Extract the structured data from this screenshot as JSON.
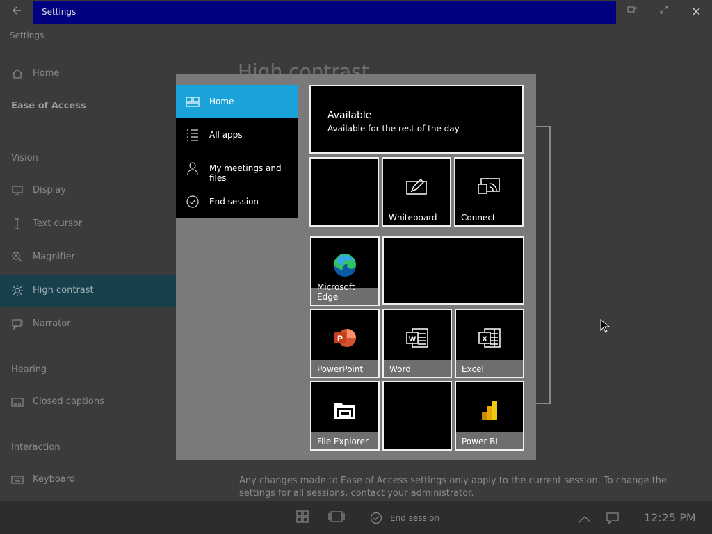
{
  "window": {
    "title": "Settings",
    "back_icon": "back-arrow-icon",
    "controls": [
      "pin-icon",
      "expand-icon",
      "close-icon"
    ]
  },
  "sidebar": {
    "app_caption": "Settings",
    "home": {
      "label": "Home",
      "icon": "home-icon"
    },
    "section": "Ease of Access",
    "groups": [
      {
        "heading": "Vision",
        "items": [
          {
            "label": "Display",
            "icon": "monitor-icon"
          },
          {
            "label": "Text cursor",
            "icon": "text-cursor-icon"
          },
          {
            "label": "Magnifier",
            "icon": "magnifier-icon"
          },
          {
            "label": "High contrast",
            "icon": "contrast-sun-icon",
            "active": true
          },
          {
            "label": "Narrator",
            "icon": "narrator-icon"
          }
        ]
      },
      {
        "heading": "Hearing",
        "items": [
          {
            "label": "Closed captions",
            "icon": "captions-icon"
          }
        ]
      },
      {
        "heading": "Interaction",
        "items": [
          {
            "label": "Keyboard",
            "icon": "keyboard-icon"
          }
        ]
      }
    ]
  },
  "main": {
    "title": "High contrast",
    "footnote": "Any changes made to Ease of Access settings only apply to the current session. To change the settings for all sessions, contact your administrator."
  },
  "start_menu": {
    "nav": [
      {
        "label": "Home",
        "icon": "home-tiles-icon",
        "active": true
      },
      {
        "label": "All apps",
        "icon": "list-icon"
      },
      {
        "label": "My meetings and files",
        "icon": "person-icon"
      },
      {
        "label": "End session",
        "icon": "check-circle-icon"
      }
    ],
    "status": {
      "title": "Available",
      "subtitle": "Available for the rest of the day"
    },
    "tiles": {
      "whiteboard": "Whiteboard",
      "connect": "Connect",
      "edge": "Microsoft Edge",
      "powerpoint": "PowerPoint",
      "word": "Word",
      "excel": "Excel",
      "explorer": "File Explorer",
      "powerbi": "Power BI"
    },
    "colors": {
      "accent": "#1aa3d8",
      "tile_bg": "#000000",
      "tile_border": "#f0f0f0"
    }
  },
  "taskbar": {
    "banner": "",
    "end_session": "End session",
    "clock": "12:25 PM",
    "icons": [
      "windows-start-icon",
      "task-view-icon",
      "end-session-icon",
      "chevron-up-icon",
      "notification-icon"
    ]
  }
}
